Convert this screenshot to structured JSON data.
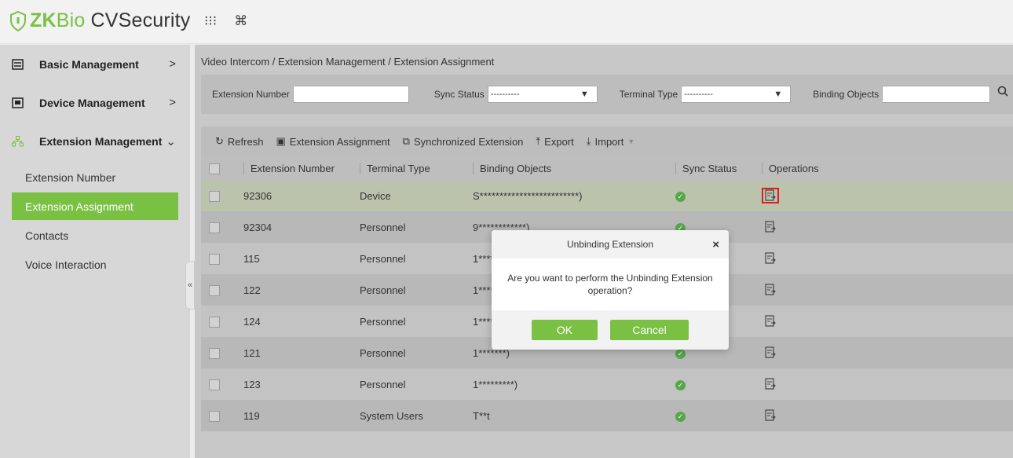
{
  "app": {
    "logo_zk": "ZK",
    "logo_bio": "Bio",
    "logo_cvs": "CVSecurity"
  },
  "topbar": {
    "grid_icon": "⁝⁝⁝",
    "cmd_icon": "⌘"
  },
  "sidebar": {
    "items": [
      {
        "label": "Basic Management",
        "arrow": ">"
      },
      {
        "label": "Device Management",
        "arrow": ">"
      },
      {
        "label": "Extension Management",
        "arrow": "⌄"
      }
    ],
    "subitems": [
      {
        "label": "Extension Number"
      },
      {
        "label": "Extension Assignment"
      },
      {
        "label": "Contacts"
      },
      {
        "label": "Voice Interaction"
      }
    ],
    "collapse": "«"
  },
  "breadcrumb": "Video Intercom / Extension Management / Extension Assignment",
  "filter": {
    "extension_number_label": "Extension Number",
    "sync_status_label": "Sync Status",
    "sync_status_value": "----------",
    "terminal_type_label": "Terminal Type",
    "terminal_type_value": "----------",
    "binding_objects_label": "Binding Objects"
  },
  "toolbar": {
    "refresh": "Refresh",
    "extension_assignment": "Extension Assignment",
    "synchronized_extension": "Synchronized Extension",
    "export": "Export",
    "import": "Import"
  },
  "table": {
    "headers": [
      "Extension Number",
      "Terminal Type",
      "Binding Objects",
      "Sync Status",
      "Operations"
    ],
    "rows": [
      {
        "ext": "92306",
        "type": "Device",
        "binding": "S*************************)"
      },
      {
        "ext": "92304",
        "type": "Personnel",
        "binding": "9************)"
      },
      {
        "ext": "115",
        "type": "Personnel",
        "binding": "1******)"
      },
      {
        "ext": "122",
        "type": "Personnel",
        "binding": "1******)"
      },
      {
        "ext": "124",
        "type": "Personnel",
        "binding": "1******)"
      },
      {
        "ext": "121",
        "type": "Personnel",
        "binding": "1*******)"
      },
      {
        "ext": "123",
        "type": "Personnel",
        "binding": "1*********)"
      },
      {
        "ext": "119",
        "type": "System Users",
        "binding": "T**t"
      }
    ]
  },
  "modal": {
    "title": "Unbinding Extension",
    "close": "×",
    "message": "Are you want to perform the Unbinding Extension operation?",
    "ok": "OK",
    "cancel": "Cancel"
  },
  "colors": {
    "accent": "#7ac143",
    "status_ok": "#55a84a",
    "marker": "#e31b1b"
  }
}
